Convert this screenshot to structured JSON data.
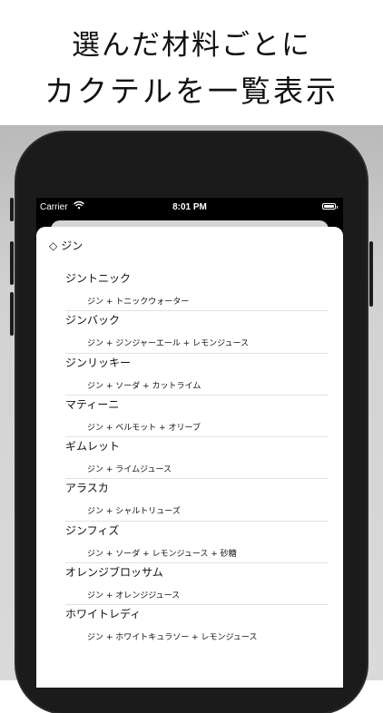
{
  "caption": {
    "line1": "選んだ材料ごとに",
    "line2": "カクテルを一覧表示"
  },
  "status_bar": {
    "carrier": "Carrier",
    "time": "8:01 PM",
    "wifi_icon": "wifi-icon",
    "battery_icon": "battery-icon"
  },
  "section": {
    "icon": "diamond-icon",
    "icon_glyph": "◇",
    "title": "ジン"
  },
  "cocktails": [
    {
      "name": "ジントニック",
      "ingredients": "ジン + トニックウォーター"
    },
    {
      "name": "ジンバック",
      "ingredients": "ジン + ジンジャーエール + レモンジュース"
    },
    {
      "name": "ジンリッキー",
      "ingredients": "ジン + ソーダ + カットライム"
    },
    {
      "name": "マティーニ",
      "ingredients": "ジン + ベルモット + オリーブ"
    },
    {
      "name": "ギムレット",
      "ingredients": "ジン + ライムジュース"
    },
    {
      "name": "アラスカ",
      "ingredients": "ジン + シャルトリューズ"
    },
    {
      "name": "ジンフィズ",
      "ingredients": "ジン + ソーダ + レモンジュース + 砂糖"
    },
    {
      "name": "オレンジブロッサム",
      "ingredients": "ジン + オレンジジュース"
    },
    {
      "name": "ホワイトレディ",
      "ingredients": "ジン + ホワイトキュラソー + レモンジュース"
    }
  ]
}
